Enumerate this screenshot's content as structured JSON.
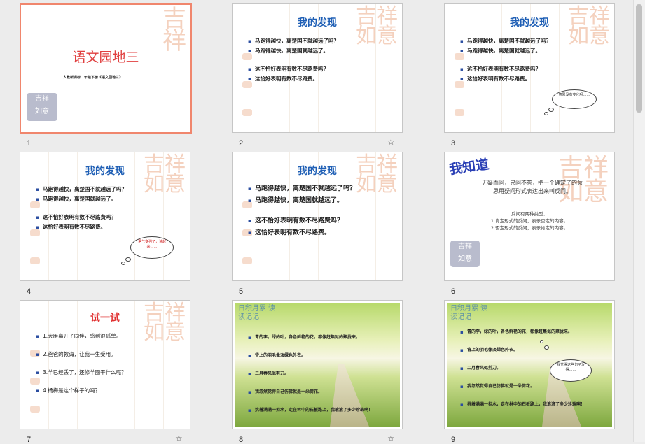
{
  "slides": [
    {
      "num": "1",
      "title": "语文园地三",
      "subtitle": "人教新课标二年级下册《语文园地三》",
      "seal": "吉祥如意"
    },
    {
      "num": "2",
      "title": "我的发现",
      "points": [
        "马跑得越快，离楚国不就越远了吗？",
        "马跑得越快，离楚国就越远了。",
        "这不恰好表明有数不尽路费吗？",
        "这恰好表明有数不尽路费。"
      ]
    },
    {
      "num": "3",
      "title": "我的发现",
      "points": [
        "马跑得越快，离楚国不就越远了吗？",
        "马跑得越快，离楚国就越远了。",
        "这不恰好表明有数不尽路费吗？",
        "这恰好表明有数不尽路费。"
      ],
      "bubble": "意思没有变化呀……"
    },
    {
      "num": "4",
      "title": "我的发现",
      "points": [
        "马跑得越快，离楚国不就越远了吗？",
        "马跑得越快，离楚国就越远了。",
        "这不恰好表明有数不尽路费吗？",
        "这恰好表明有数不尽路费。"
      ],
      "bubble": "语气变强了，读起来……"
    },
    {
      "num": "5",
      "title": "我的发现",
      "points": [
        "马跑得越快，离楚国不就越远了吗？",
        "马跑得越快，离楚国就越远了。",
        "这不恰好表明有数不尽路费吗？",
        "这恰好表明有数不尽路费。"
      ]
    },
    {
      "num": "6",
      "heading": "我知道",
      "p1": "无疑而问，只问不答，把一个确定了的意思用疑问形式表达出来叫反问。",
      "p2": "反问有两种类型：",
      "p3": "1.肯定形式的反问，表示否定的内容。",
      "p4": "2.否定形式的反问，表示肯定的内容。"
    },
    {
      "num": "7",
      "title": "试一试",
      "points": [
        "1.大雁离开了同伴，感到很孤单。",
        "2.爸爸的教诲，让我一生受用。",
        "3.羊已经丢了，还修羊圈干什么呢？",
        "4.杨梅是这个样子的吗？"
      ]
    },
    {
      "num": "8",
      "heading": "日积月累 读读记记",
      "points": [
        "青的李，绿的叶，各色鲜艳的花，都像赶集似的聚拢来。",
        "背上的羽毛像淡绿色外衣。",
        "二月春风似剪刀。",
        "我忽然觉得自己仿佛就是一朵荷花。",
        "挑着满满一担水，走在林中的石板路上，我滚滚了多少珍珠啊！"
      ]
    },
    {
      "num": "9",
      "heading": "日积月累 读读记记",
      "points": [
        "青的李，绿的叶，各色鲜艳的花，都像赶集似的聚拢来。",
        "背上的羽毛像淡绿色外衣。",
        "二月春风似剪刀。",
        "我忽然觉得自己仿佛就是一朵荷花。",
        "挑着满满一担水，走在林中的石板路上，我滚滚了多少珍珠啊！"
      ],
      "bubble": "我觉得这些句子写得……"
    }
  ],
  "colors": {
    "title_blue": "#1f5fb5",
    "red": "#e02020",
    "selected_border": "#f0866d"
  }
}
